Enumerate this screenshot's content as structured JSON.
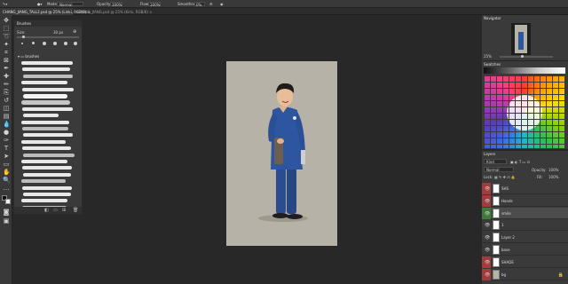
{
  "options_bar": {
    "mode_label": "Mode:",
    "mode_value": "Normal",
    "opacity_label": "Opacity:",
    "opacity_value": "100%",
    "flow_label": "Flow:",
    "flow_value": "100%",
    "smoothing_label": "Smoothing:",
    "smoothing_value": "0%",
    "gear_icon": "gear-icon",
    "colors": {
      "bar": "#393939",
      "field": "#2a2a2a"
    }
  },
  "tabs": [
    {
      "label": "CHANG_JIANG_TALL2.psd @ 25% (Linki, RGB/8) ×",
      "active": true
    },
    {
      "label": "CHANG_JIANG.psd @ 25% (Kimi, RGB/8) ×",
      "active": false
    }
  ],
  "brushes_panel": {
    "title": "Brushes",
    "size_label": "Size:",
    "size_value": "30 px",
    "folder_label": "brushes",
    "stroke_count": 23
  },
  "canvas": {
    "background": "#b7b2a7",
    "workspace": "#282828"
  },
  "navigator": {
    "title": "Navigator",
    "zoom": "25%"
  },
  "swatches": {
    "title": "Swatches"
  },
  "layers": {
    "title": "Layers",
    "kind_label": "Kind",
    "blend_mode": "Normal",
    "opacity_label": "Opacity:",
    "opacity_value": "100%",
    "lock_label": "Lock:",
    "fill_label": "Fill:",
    "fill_value": "100%",
    "items": [
      {
        "name": "SHS",
        "tag_color": "#a23b3b",
        "thumb": "#ffffff"
      },
      {
        "name": "Hands",
        "tag_color": "#a23b3b",
        "thumb": "#ffffff"
      },
      {
        "name": "smile",
        "tag_color": "#3e7b3a",
        "thumb": "#ffffff",
        "selected": true
      },
      {
        "name": "1",
        "tag_color": "",
        "thumb": "#ffffff"
      },
      {
        "name": "Layer 2",
        "tag_color": "",
        "thumb": "#ffffff"
      },
      {
        "name": "base",
        "tag_color": "",
        "thumb": "#ffffff"
      },
      {
        "name": "SHADE",
        "tag_color": "#a23b3b",
        "thumb": "#ffffff"
      },
      {
        "name": "bg",
        "tag_color": "#a23b3b",
        "thumb": "#b7b2a7"
      }
    ]
  }
}
